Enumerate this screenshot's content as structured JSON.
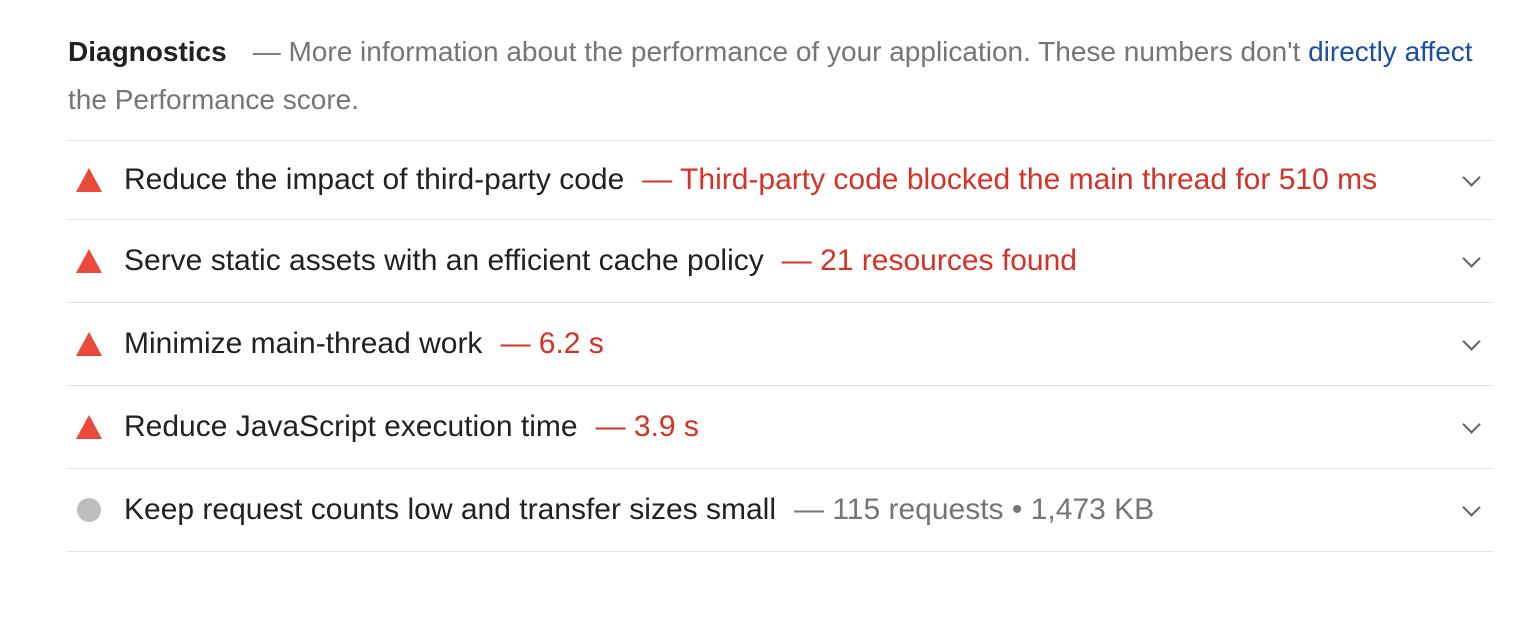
{
  "section": {
    "title": "Diagnostics",
    "description_prefix": "— More information about the performance of your application. These numbers don't ",
    "description_link": "directly affect",
    "description_suffix": " the Performance score."
  },
  "colors": {
    "fail": "#eb4a3b",
    "fail_text": "#d93025",
    "info": "#bdbdbd",
    "link": "#1a4fa3"
  },
  "audits": [
    {
      "title": "Reduce the impact of third-party code",
      "display_value": "— Third-party code blocked the main thread for 510 ms",
      "status": "fail",
      "icon": "warning-triangle-icon"
    },
    {
      "title": "Serve static assets with an efficient cache policy",
      "display_value": "— 21 resources found",
      "status": "fail",
      "icon": "warning-triangle-icon"
    },
    {
      "title": "Minimize main-thread work",
      "display_value": "— 6.2 s",
      "status": "fail",
      "icon": "warning-triangle-icon"
    },
    {
      "title": "Reduce JavaScript execution time",
      "display_value": "— 3.9 s",
      "status": "fail",
      "icon": "warning-triangle-icon"
    },
    {
      "title": "Keep request counts low and transfer sizes small",
      "display_value": "— 115 requests • 1,473 KB",
      "status": "info",
      "icon": "gray-circle-icon"
    }
  ]
}
